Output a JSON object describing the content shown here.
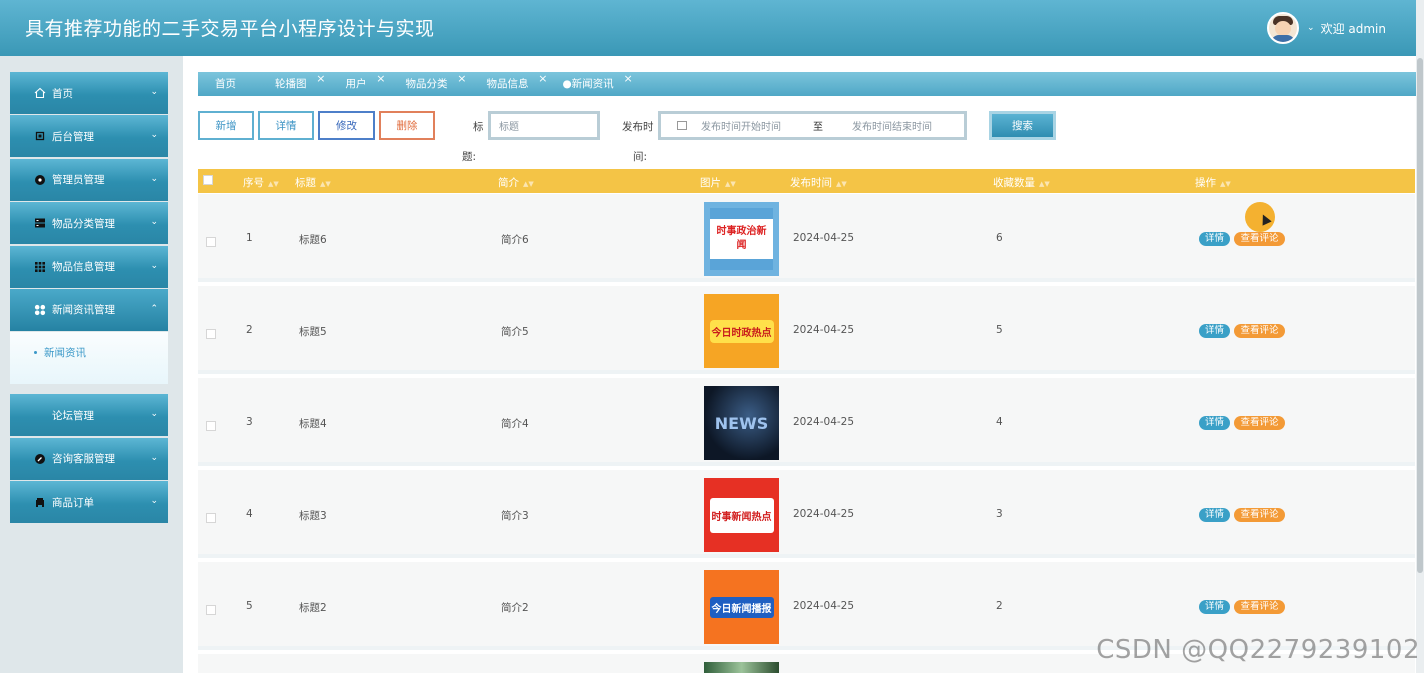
{
  "header": {
    "title": "具有推荐功能的二手交易平台小程序设计与实现",
    "welcome": "欢迎 admin"
  },
  "sidebar": {
    "items": [
      {
        "label": "首页",
        "icon": "home-icon"
      },
      {
        "label": "后台管理",
        "icon": "chip-icon"
      },
      {
        "label": "管理员管理",
        "icon": "admin-icon"
      },
      {
        "label": "物品分类管理",
        "icon": "category-icon"
      },
      {
        "label": "物品信息管理",
        "icon": "grid-icon"
      },
      {
        "label": "新闻资讯管理",
        "icon": "apps-icon"
      }
    ],
    "submenu": {
      "label": "新闻资讯"
    },
    "items2": [
      {
        "label": "论坛管理"
      },
      {
        "label": "咨询客服管理",
        "icon": "chat-icon"
      },
      {
        "label": "商品订单",
        "icon": "car-icon"
      }
    ]
  },
  "tabs": [
    "首页",
    "轮播图",
    "用户",
    "物品分类",
    "物品信息",
    "●新闻资讯"
  ],
  "toolbar": {
    "add": "新增",
    "detail": "详情",
    "edit": "修改",
    "delete": "删除",
    "title_label_1": "标",
    "title_label_2": "题:",
    "title_placeholder": "标题",
    "time_label_1": "发布时",
    "time_label_2": "间:",
    "time_start_placeholder": "发布时间开始时间",
    "time_to": "至",
    "time_end_placeholder": "发布时间结束时间",
    "search": "搜索"
  },
  "table": {
    "headers": [
      "序号",
      "标题",
      "简介",
      "图片",
      "发布时间",
      "收藏数量",
      "操作"
    ],
    "rows": [
      {
        "no": "1",
        "title": "标题6",
        "intro": "简介6",
        "image_text": "时事政治新闻",
        "date": "2024-04-25",
        "fav": "6"
      },
      {
        "no": "2",
        "title": "标题5",
        "intro": "简介5",
        "image_text": "今日时政热点",
        "date": "2024-04-25",
        "fav": "5"
      },
      {
        "no": "3",
        "title": "标题4",
        "intro": "简介4",
        "image_text": "NEWS",
        "date": "2024-04-25",
        "fav": "4"
      },
      {
        "no": "4",
        "title": "标题3",
        "intro": "简介3",
        "image_text": "时事新闻热点",
        "date": "2024-04-25",
        "fav": "3"
      },
      {
        "no": "5",
        "title": "标题2",
        "intro": "简介2",
        "image_text": "今日新闻播报",
        "date": "2024-04-25",
        "fav": "2"
      }
    ],
    "op_detail": "详情",
    "op_comment": "查看评论"
  },
  "watermark": "CSDN @QQ2279239102"
}
